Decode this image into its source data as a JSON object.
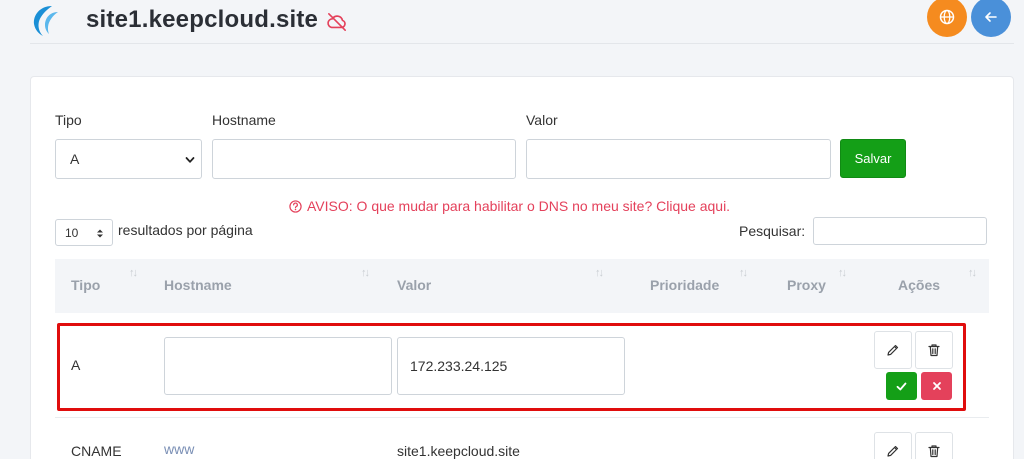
{
  "header": {
    "site_title": "site1.keepcloud.site"
  },
  "form": {
    "type_label": "Tipo",
    "type_value": "A",
    "hostname_label": "Hostname",
    "hostname_value": "",
    "value_label": "Valor",
    "value_value": "",
    "save_label": "Salvar"
  },
  "warning": {
    "text": "AVISO: O que mudar para habilitar o DNS no meu site? Clique aqui."
  },
  "table_controls": {
    "page_length": "10",
    "page_length_label": "resultados por página",
    "search_label": "Pesquisar:",
    "search_value": ""
  },
  "table": {
    "columns": [
      "Tipo",
      "Hostname",
      "Valor",
      "Prioridade",
      "Proxy",
      "Ações"
    ],
    "rows": [
      {
        "type": "A",
        "hostname": "",
        "value": "172.233.24.125",
        "editing": true
      },
      {
        "type": "CNAME",
        "hostname": "www",
        "value": "site1.keepcloud.site",
        "editing": false
      }
    ]
  },
  "colors": {
    "accent_orange": "#f58b1f",
    "accent_blue": "#4a90d9",
    "success": "#149f17",
    "danger": "#e4415b",
    "highlight": "#e00d0d"
  },
  "icons": {
    "logo": "keepcloud-logo-icon",
    "cloud_status": "cloud-off-icon",
    "globe": "globe-icon",
    "back": "arrow-left-icon",
    "warning": "question-circle-icon",
    "edit": "pencil-icon",
    "delete": "trash-icon",
    "confirm": "check-icon",
    "cancel": "close-icon"
  }
}
